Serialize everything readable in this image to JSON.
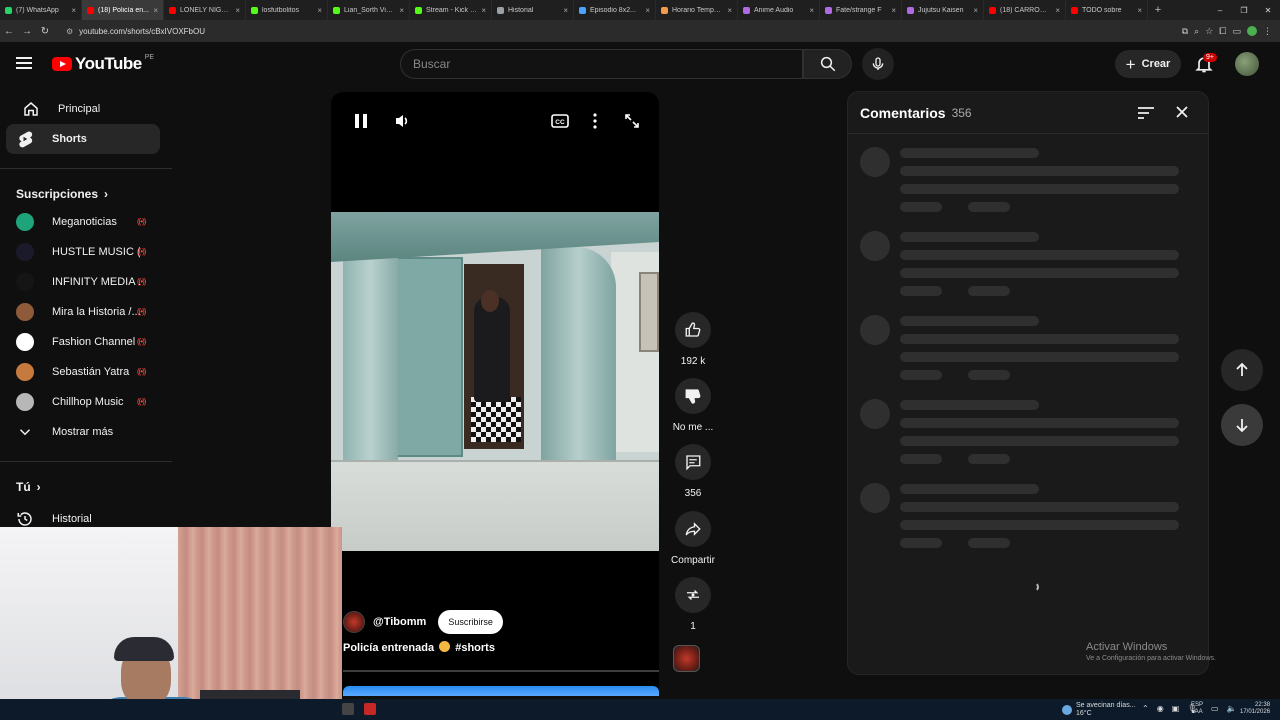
{
  "browser": {
    "tabs": [
      {
        "title": "(7) WhatsApp",
        "color": "#25d366",
        "active": false
      },
      {
        "title": "(18) Policía en...",
        "color": "#ff0000",
        "active": true
      },
      {
        "title": "LONELY NIGHT p",
        "color": "#ff0000",
        "active": false
      },
      {
        "title": "losfutbolitos",
        "color": "#53fc18",
        "active": false
      },
      {
        "title": "Lian_Sorth Video",
        "color": "#53fc18",
        "active": false
      },
      {
        "title": "Stream - Kick Da",
        "color": "#53fc18",
        "active": false
      },
      {
        "title": "Historial",
        "color": "#9aa0a6",
        "active": false
      },
      {
        "title": "Episodio 8x2...",
        "color": "#4aa3ff",
        "active": false
      },
      {
        "title": "Horario Tempora",
        "color": "#f2994a",
        "active": false
      },
      {
        "title": "Anime Audio",
        "color": "#b06be3",
        "active": false
      },
      {
        "title": "Fate/strange F",
        "color": "#b06be3",
        "active": false
      },
      {
        "title": "Jujutsu Kaisen",
        "color": "#b06be3",
        "active": false
      },
      {
        "title": "(18) CARROS DE",
        "color": "#ff0000",
        "active": false
      },
      {
        "title": "TODO sobre",
        "color": "#ff0000",
        "active": false
      }
    ],
    "new_tab": "+",
    "url": "youtube.com/shorts/cBxIVOXFbOU",
    "window_controls": [
      "–",
      "❐",
      "✕"
    ]
  },
  "header": {
    "logo_text": "YouTube",
    "country": "PE",
    "search_placeholder": "Buscar",
    "create_label": "Crear",
    "notif_badge": "9+"
  },
  "sidebar": {
    "main": [
      {
        "label": "Principal",
        "icon": "home-icon",
        "active": false
      },
      {
        "label": "Shorts",
        "icon": "shorts-icon",
        "active": true
      }
    ],
    "subs_heading": "Suscripciones",
    "subs": [
      {
        "name": "Meganoticias",
        "color": "#1fa37a"
      },
      {
        "name": "HUSTLE MUSIC (...",
        "color": "#1a1a2a"
      },
      {
        "name": "INFINITY MEDIA ...",
        "color": "#151515"
      },
      {
        "name": "Mira la Historia /...",
        "color": "#8e5a3a"
      },
      {
        "name": "Fashion Channel",
        "color": "#ffffff"
      },
      {
        "name": "Sebastián Yatra",
        "color": "#c77a3e"
      },
      {
        "name": "Chillhop Music",
        "color": "#b7b7b7"
      }
    ],
    "show_more": "Mostrar más",
    "you_heading": "Tú",
    "history": "Historial"
  },
  "short": {
    "channel": "@Tibomm",
    "subscribe_label": "Suscribirse",
    "caption": "Policía entrenada",
    "hashtag": "#shorts"
  },
  "actions": {
    "likes": "192 k",
    "dislike": "No me ...",
    "comments": "356",
    "share": "Compartir",
    "remix": "1"
  },
  "comments_panel": {
    "title": "Comentarios",
    "count": "356"
  },
  "watermark": {
    "line1": "Activar Windows",
    "line2": "Ve a Configuración para activar Windows."
  },
  "taskbar": {
    "weather_line1": "Se avecinan días...",
    "weather_line2": "16°C",
    "lang_line1": "ESP",
    "lang_line2": "LAA",
    "time": "22:38",
    "date": "17/01/2026"
  },
  "colors": {
    "accent_red": "#ff0000",
    "live_red": "#ff4e45",
    "bg": "#0f0f0f"
  }
}
